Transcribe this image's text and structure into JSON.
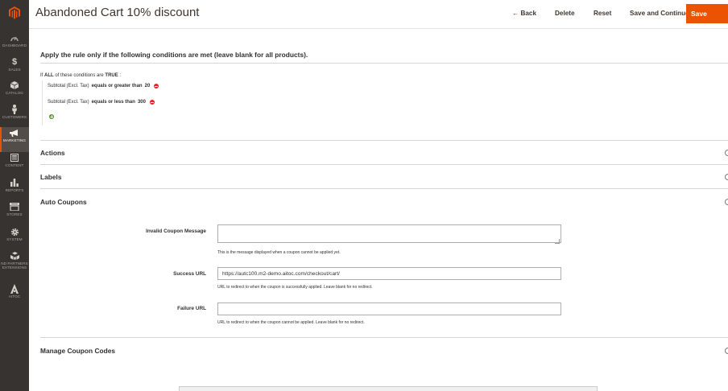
{
  "header": {
    "title": "Abandoned Cart 10% discount",
    "back_label": "← Back",
    "delete_label": "Delete",
    "reset_label": "Reset",
    "save_continue_label": "Save and Continue Edit",
    "save_label": "Save"
  },
  "sidebar": {
    "items": [
      {
        "label": "DASHBOARD",
        "icon": "dashboard-icon"
      },
      {
        "label": "SALES",
        "icon": "dollar-icon"
      },
      {
        "label": "CATALOG",
        "icon": "cube-icon"
      },
      {
        "label": "CUSTOMERS",
        "icon": "person-icon"
      },
      {
        "label": "MARKETING",
        "icon": "megaphone-icon",
        "active": true
      },
      {
        "label": "CONTENT",
        "icon": "layout-icon"
      },
      {
        "label": "REPORTS",
        "icon": "bar-chart-icon"
      },
      {
        "label": "STORES",
        "icon": "store-icon"
      },
      {
        "label": "SYSTEM",
        "icon": "gear-icon"
      },
      {
        "label": "FIND PARTNERS & EXTENSIONS",
        "label_line1": "ND PARTNERS",
        "label_line2": "EXTENSIONS",
        "icon": "blocks-icon"
      },
      {
        "label": "AITOC",
        "icon": "aitoc-icon"
      }
    ]
  },
  "conditions": {
    "title": "Apply the rule only if the following conditions are met (leave blank for all products).",
    "if_prefix": "If",
    "aggregator": "ALL",
    "middle": "of these conditions are",
    "value": "TRUE",
    "suffix": ":",
    "rules": [
      {
        "attribute": "Subtotal (Excl. Tax)",
        "operator": "equals or greater than",
        "value": "20"
      },
      {
        "attribute": "Subtotal (Excl. Tax)",
        "operator": "equals or less than",
        "value": "300"
      }
    ]
  },
  "sections": {
    "actions": "Actions",
    "labels": "Labels",
    "auto_coupons": "Auto Coupons",
    "manage_codes": "Manage Coupon Codes"
  },
  "auto_coupons": {
    "invalid_label": "Invalid Coupon Message",
    "invalid_value": "",
    "invalid_note": "This is the message displayed when a coupon cannot be applied yet.",
    "success_label": "Success URL",
    "success_value": "https://autc100.m2-demo.aitoc.com/checkout/cart/",
    "success_note": "URL to redirect to when the coupon is successfully applied. Leave blank for no redirect.",
    "failure_label": "Failure URL",
    "failure_value": "",
    "failure_note": "URL to redirect to when the coupon cannot be applied. Leave blank for no redirect."
  },
  "colors": {
    "accent": "#eb5202",
    "sidebar_bg": "#373330",
    "remove": "#e22626",
    "add": "#4c9a2a"
  }
}
